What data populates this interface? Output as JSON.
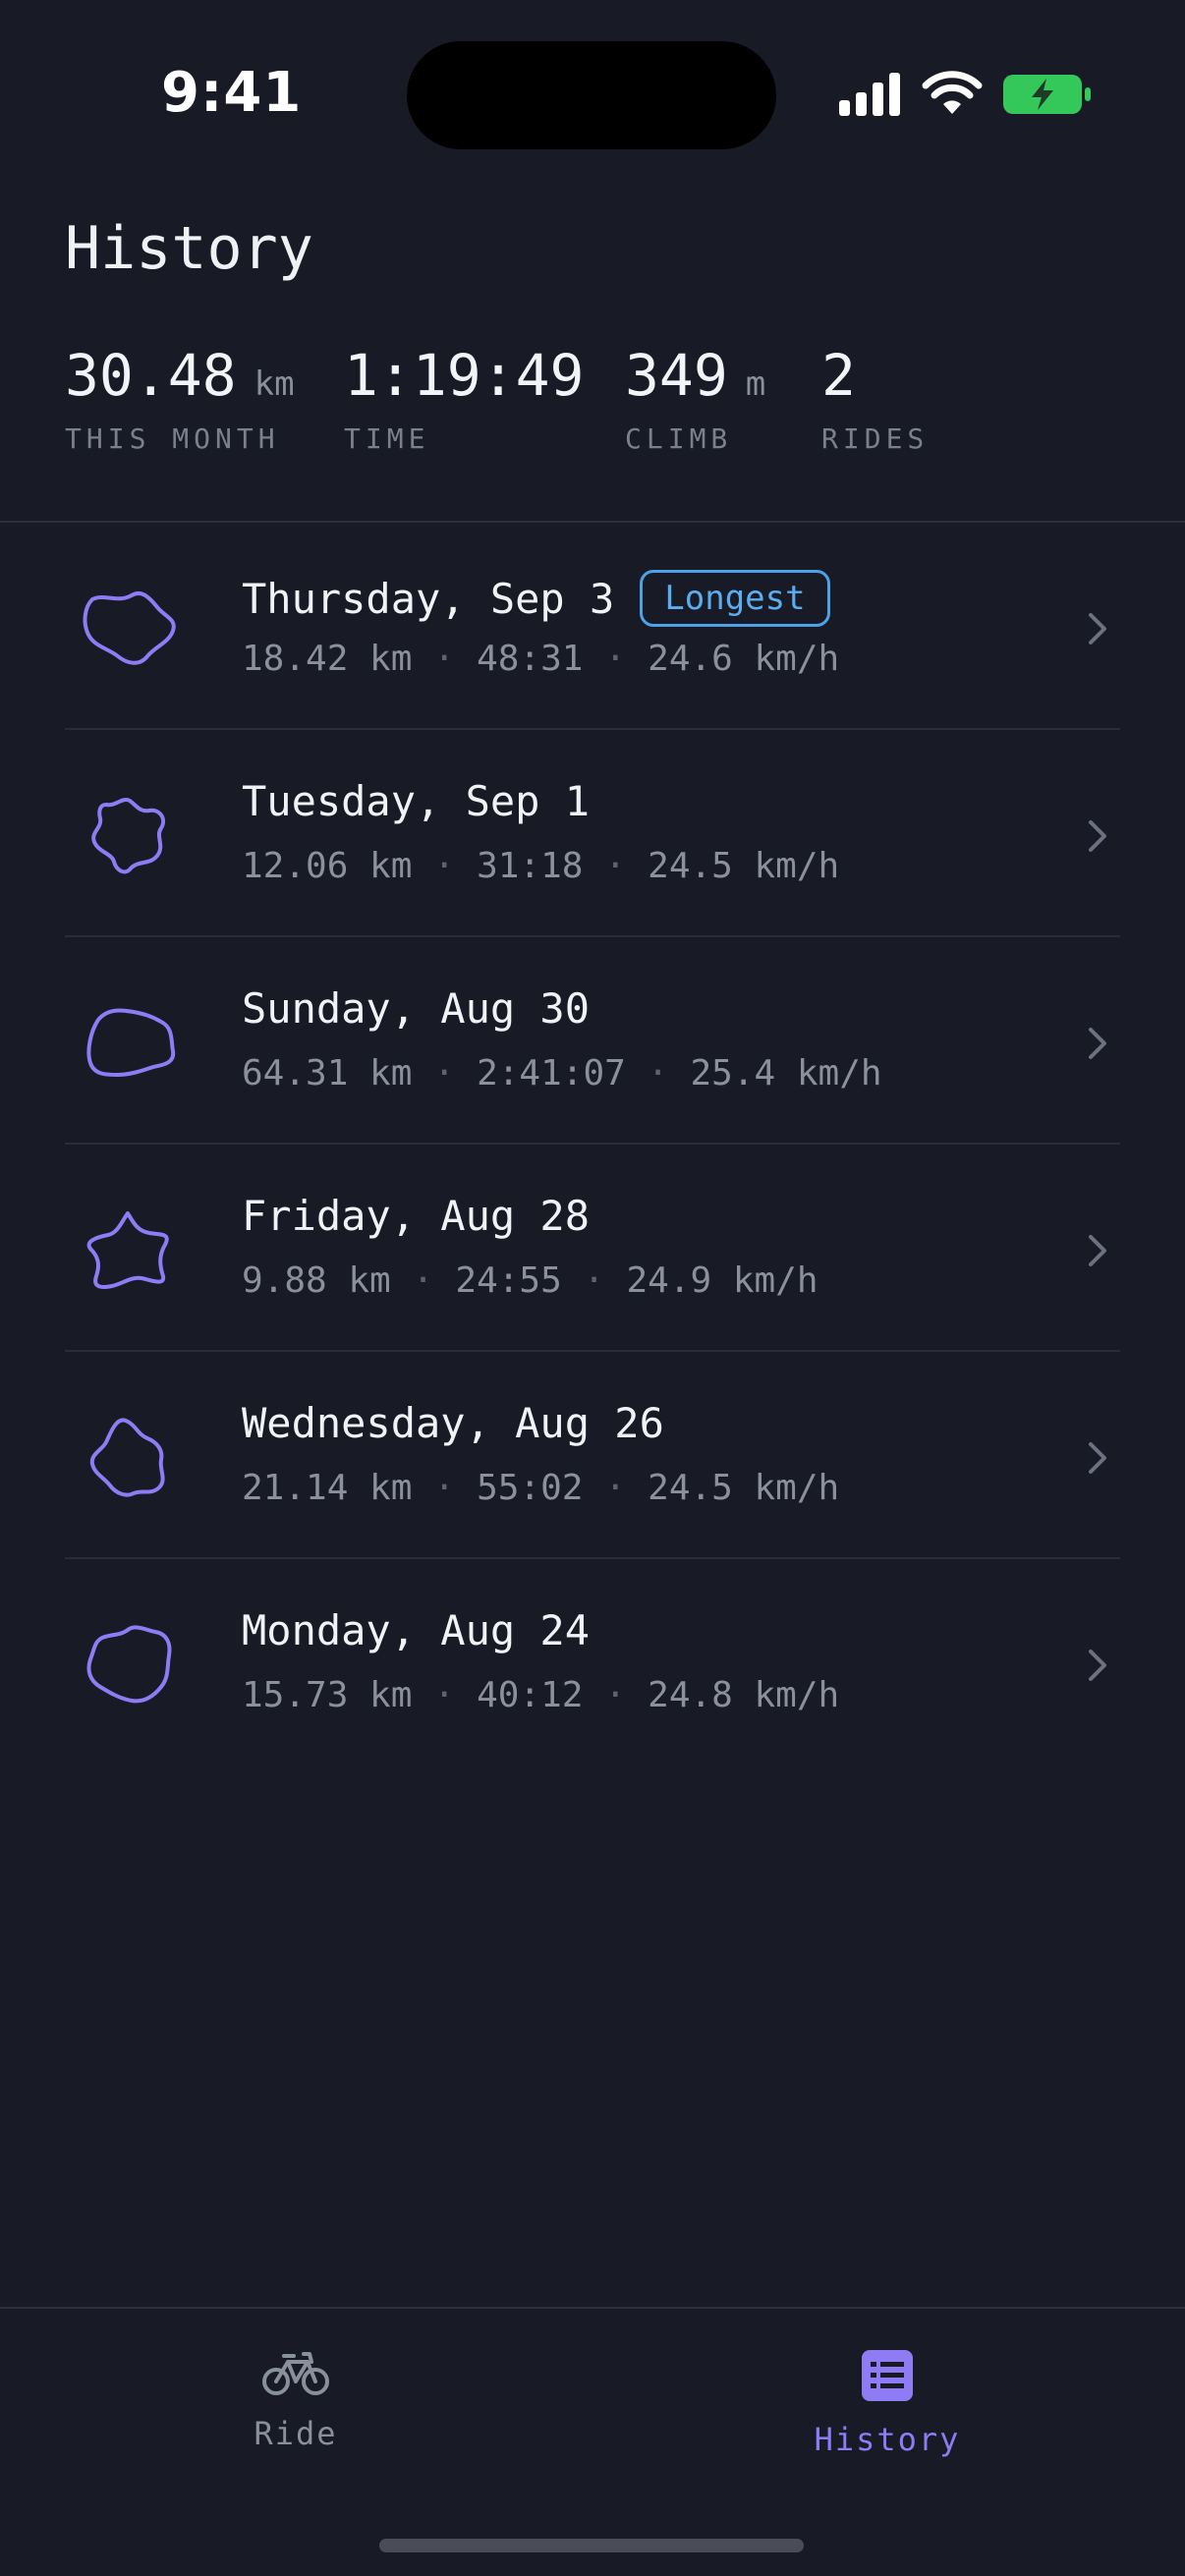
{
  "status_bar": {
    "time": "9:41"
  },
  "header": {
    "title": "History",
    "stats": [
      {
        "value": "30.48",
        "unit": "km",
        "label": "THIS MONTH"
      },
      {
        "value": "1:19:49",
        "unit": "",
        "label": "TIME"
      },
      {
        "value": "349",
        "unit": "m",
        "label": "CLIMB"
      },
      {
        "value": "2",
        "unit": "",
        "label": "RIDES"
      }
    ]
  },
  "rides": [
    {
      "date": "Thursday, Sep 3",
      "distance": "18.42 km",
      "duration": "48:31",
      "speed": "24.6 km/h",
      "badge": "Longest"
    },
    {
      "date": "Tuesday, Sep 1",
      "distance": "12.06 km",
      "duration": "31:18",
      "speed": "24.5 km/h"
    },
    {
      "date": "Sunday, Aug 30",
      "distance": "64.31 km",
      "duration": "2:41:07",
      "speed": "25.4 km/h"
    },
    {
      "date": "Friday, Aug 28",
      "distance": "9.88 km",
      "duration": "24:55",
      "speed": "24.9 km/h"
    },
    {
      "date": "Wednesday, Aug 26",
      "distance": "21.14 km",
      "duration": "55:02",
      "speed": "24.5 km/h"
    },
    {
      "date": "Monday, Aug 24",
      "distance": "15.73 km",
      "duration": "40:12",
      "speed": "24.8 km/h"
    }
  ],
  "separator": "·",
  "tabs": [
    {
      "label": "Ride",
      "icon": "bicycle-icon",
      "active": false
    },
    {
      "label": "History",
      "icon": "list-icon",
      "active": true
    }
  ],
  "colors": {
    "accent": "#8f7cf5",
    "badge": "#4ea1e6",
    "background": "#181a26"
  }
}
